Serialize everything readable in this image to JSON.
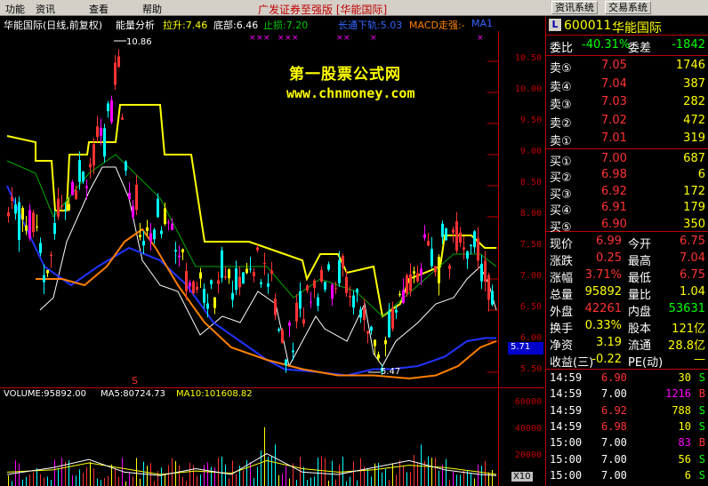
{
  "menu": {
    "items": [
      "功能",
      "资讯",
      "查看",
      "帮助"
    ],
    "title": "广发证券至强版 [华能国际]",
    "buttons": [
      "资讯系统",
      "交易系统"
    ]
  },
  "chart": {
    "header": {
      "title": "华能国际(日线,前复权)",
      "indicator": "能量分析",
      "lashen": "拉升:7.46",
      "dibu": "底部:6.46",
      "zhisun": "止损:7.20",
      "qushi": "长通下轨:5.03",
      "macd": "MACD走强:-",
      "ma": "MA1"
    },
    "yticks": [
      "10.50",
      "10.00",
      "9.50",
      "9.00",
      "8.50",
      "8.00",
      "7.50",
      "7.00",
      "6.50",
      "6.00",
      "5.50"
    ],
    "high_label": "10.86",
    "low_label": "5.47",
    "last_label": "5.71",
    "signal_s": "S",
    "watermark1": "第一股票公式网",
    "watermark2": "www.chnmoney.com"
  },
  "volume": {
    "header": {
      "vol": "VOLUME:95892.00",
      "ma5": "MA5:80724.73",
      "ma10": "MA10:101608.82"
    },
    "yticks": [
      "60000",
      "40000",
      "20000"
    ],
    "unit": "X10"
  },
  "panel": {
    "code": "600011",
    "name": "华能国际",
    "logo": "L",
    "weibi": {
      "label": "委比",
      "value": "-40.31%",
      "label2": "委差",
      "value2": "-1842"
    },
    "asks": [
      {
        "label": "卖⑤",
        "price": "7.05",
        "vol": "1746"
      },
      {
        "label": "卖④",
        "price": "7.04",
        "vol": "387"
      },
      {
        "label": "卖③",
        "price": "7.03",
        "vol": "282"
      },
      {
        "label": "卖②",
        "price": "7.02",
        "vol": "472"
      },
      {
        "label": "卖①",
        "price": "7.01",
        "vol": "319"
      }
    ],
    "bids": [
      {
        "label": "买①",
        "price": "7.00",
        "vol": "687"
      },
      {
        "label": "买②",
        "price": "6.98",
        "vol": "6"
      },
      {
        "label": "买③",
        "price": "6.92",
        "vol": "172"
      },
      {
        "label": "买④",
        "price": "6.91",
        "vol": "179"
      },
      {
        "label": "买⑤",
        "price": "6.90",
        "vol": "350"
      }
    ],
    "stats": [
      {
        "l1": "现价",
        "v1": "6.99",
        "l2": "今开",
        "v2": "6.75"
      },
      {
        "l1": "涨跌",
        "v1": "0.25",
        "l2": "最高",
        "v2": "7.04"
      },
      {
        "l1": "涨幅",
        "v1": "3.71%",
        "l2": "最低",
        "v2": "6.75"
      },
      {
        "l1": "总量",
        "v1": "95892",
        "l2": "量比",
        "v2": "1.04"
      },
      {
        "l1": "外盘",
        "v1": "42261",
        "l2": "内盘",
        "v2": "53631"
      },
      {
        "l1": "换手",
        "v1": "0.33%",
        "l2": "股本",
        "v2": "121亿"
      },
      {
        "l1": "净资",
        "v1": "3.19",
        "l2": "流通",
        "v2": "28.8亿"
      },
      {
        "l1": "收益(三)",
        "v1": "-0.22",
        "l2": "PE(动)",
        "v2": "—"
      }
    ],
    "ticks": [
      {
        "time": "14:59",
        "price": "6.90",
        "vol": "30",
        "side": "S"
      },
      {
        "time": "14:59",
        "price": "7.00",
        "vol": "1216",
        "side": "B"
      },
      {
        "time": "14:59",
        "price": "6.92",
        "vol": "788",
        "side": "S"
      },
      {
        "time": "14:59",
        "price": "6.98",
        "vol": "10",
        "side": "S"
      },
      {
        "time": "15:00",
        "price": "7.00",
        "vol": "83",
        "side": "B"
      },
      {
        "time": "15:00",
        "price": "7.00",
        "vol": "56",
        "side": "S"
      },
      {
        "time": "15:00",
        "price": "7.00",
        "vol": "6",
        "side": "S"
      }
    ]
  },
  "colors": {
    "up": "#ff3333",
    "down": "#00ffff",
    "yellow": "#ffff00",
    "green": "#00ff00",
    "magenta": "#ff00ff",
    "blue": "#3366ff",
    "orange": "#ff8000",
    "red_axis": "#c00000"
  }
}
